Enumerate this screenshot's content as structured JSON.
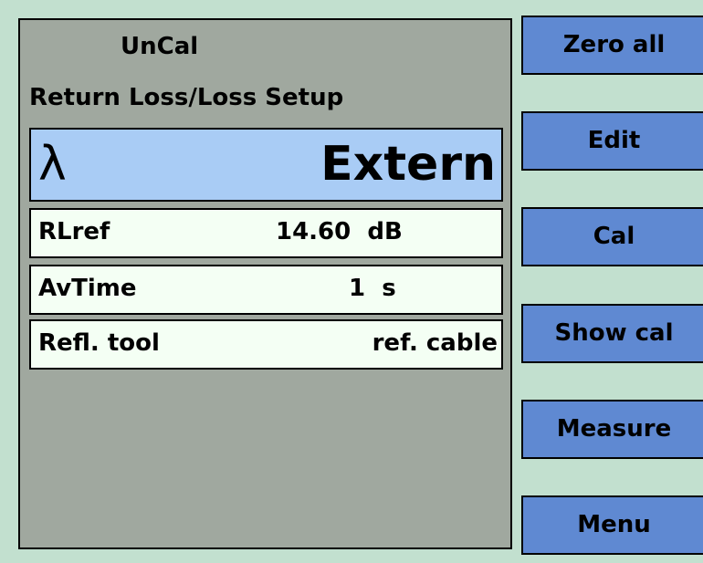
{
  "status": "UnCal",
  "setup_title": "Return Loss/Loss Setup",
  "wavelength": {
    "symbol": "λ",
    "value": "Extern"
  },
  "params": [
    {
      "label": "RLref",
      "value": "14.60  dB"
    },
    {
      "label": "AvTime",
      "value": "1  s"
    },
    {
      "label": "Refl. tool",
      "value": "ref. cable"
    }
  ],
  "softkeys": [
    "Zero all",
    "Edit",
    "Cal",
    "Show cal",
    "Measure",
    "Menu"
  ]
}
